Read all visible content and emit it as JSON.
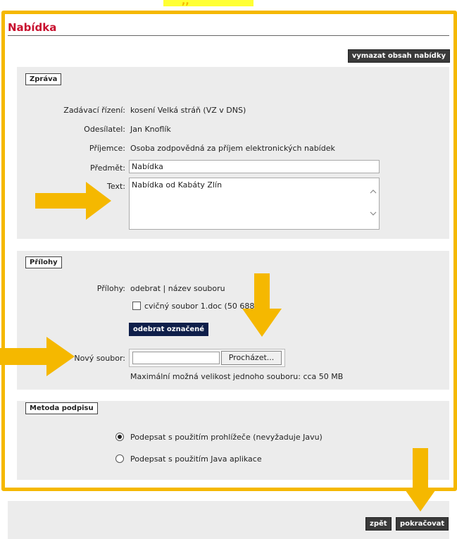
{
  "header": {
    "title": "Nabídka",
    "top_text": ",,",
    "clear_button": "vymazat obsah nabídky"
  },
  "message": {
    "legend": "Zpráva",
    "procedure_label": "Zadávací řízení:",
    "procedure_value": "kosení Velká stráň (VZ v DNS)",
    "sender_label": "Odesílatel:",
    "sender_value": "Jan Knoflík",
    "recipient_label": "Příjemce:",
    "recipient_value": "Osoba zodpovědná za příjem elektronických nabídek",
    "subject_label": "Předmět:",
    "subject_value": "Nabídka",
    "text_label": "Text:",
    "text_value": "Nabídka od Kabáty Zlín"
  },
  "attachments": {
    "legend": "Přílohy",
    "list_label": "Přílohy:",
    "list_header": "odebrat | název souboru",
    "file_item": "cvičný soubor 1.doc (50 688",
    "file_item_suffix": ")",
    "remove_selected": "odebrat označené",
    "new_file_label": "Nový soubor:",
    "browse": "Procházet...",
    "max_size": "Maximální možná velikost jednoho souboru: cca 50 MB"
  },
  "signature": {
    "legend": "Metoda podpisu",
    "opt_browser": "Podepsat s použitím prohlížeče (nevyžaduje Javu)",
    "opt_java": "Podepsat s použitím Java aplikace",
    "selected": "browser"
  },
  "footer": {
    "back": "zpět",
    "continue": "pokračovat"
  },
  "colors": {
    "accent": "#f5b800",
    "title": "#c8102e",
    "navy": "#0f1f4a"
  }
}
